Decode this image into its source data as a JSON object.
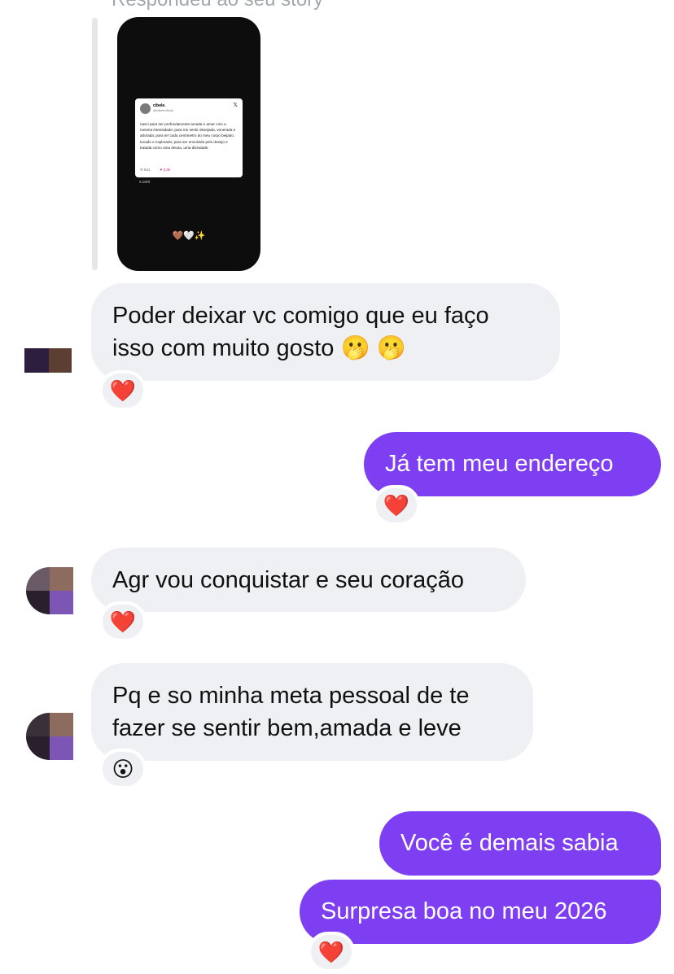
{
  "reply": {
    "caption": "Respondeu ao seu story",
    "story": {
      "tweet_name": "cibele.",
      "tweet_handle": "@cibeleoficial",
      "tweet_text": "nasci para ser profundamente amada e amar com a mesma intensidade; para me sentir desejada, venerada e adorada; para ter cada centímetro do meu corpo beijado, tocado e explorado; para ser envolvida pelo desejo e tratada como uma deusa, uma divindade.",
      "retweets": "541",
      "likes": "3,3k",
      "source": "x.com",
      "emojis": "🤎🤍✨"
    }
  },
  "messages": [
    {
      "side": "in",
      "line1": "Poder deixar vc comigo que eu faço",
      "line2": "isso com muito gosto 🫢 🫢",
      "reaction": "❤️"
    },
    {
      "side": "out",
      "text": "Já tem meu endereço",
      "reaction": "❤️"
    },
    {
      "side": "in",
      "text": "Agr vou conquistar e seu coração",
      "reaction": "❤️"
    },
    {
      "side": "in",
      "line1": "Pq e so minha meta pessoal de te",
      "line2": "fazer se sentir bem,amada e leve",
      "reaction": "😮"
    },
    {
      "side": "out",
      "text": "Você é demais sabia"
    },
    {
      "side": "out",
      "text": "Surpresa boa no meu 2026",
      "reaction": "❤️"
    }
  ],
  "colors": {
    "incoming_bubble": "#eff0f3",
    "outgoing_bubble": "#7e3ff2",
    "outgoing_text": "#ffffff"
  }
}
